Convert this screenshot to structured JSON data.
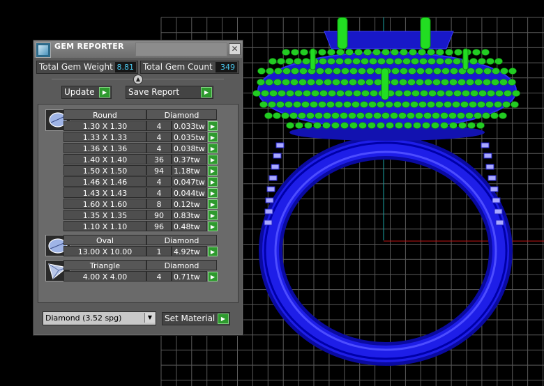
{
  "panel": {
    "title": "GEM REPORTER",
    "close_glyph": "✕",
    "total_weight_label": "Total Gem Weight",
    "total_weight_value": "8.81",
    "total_count_label": "Total Gem Count",
    "total_count_value": "349",
    "update_label": "Update",
    "save_report_label": "Save Report",
    "collapse_glyph": "▲",
    "arrow_glyph": "▶",
    "dropdown_glyph": "▼",
    "set_material_label": "Set Material",
    "material_value": "Diamond    (3.52 spg)"
  },
  "groups": [
    {
      "shape": "Round",
      "material": "Diamond",
      "icon": "round-gem-icon",
      "rows": [
        {
          "size": "1.30 X 1.30",
          "count": "4",
          "weight": "0.033tw"
        },
        {
          "size": "1.33 X 1.33",
          "count": "4",
          "weight": "0.035tw"
        },
        {
          "size": "1.36 X 1.36",
          "count": "4",
          "weight": "0.038tw"
        },
        {
          "size": "1.40 X 1.40",
          "count": "36",
          "weight": "0.37tw"
        },
        {
          "size": "1.50 X 1.50",
          "count": "94",
          "weight": "1.18tw"
        },
        {
          "size": "1.46 X 1.46",
          "count": "4",
          "weight": "0.047tw"
        },
        {
          "size": "1.43 X 1.43",
          "count": "4",
          "weight": "0.044tw"
        },
        {
          "size": "1.60 X 1.60",
          "count": "8",
          "weight": "0.12tw"
        },
        {
          "size": "1.35 X 1.35",
          "count": "90",
          "weight": "0.83tw"
        },
        {
          "size": "1.10 X 1.10",
          "count": "96",
          "weight": "0.48tw"
        }
      ]
    },
    {
      "shape": "Oval",
      "material": "Diamond",
      "icon": "oval-gem-icon",
      "rows": [
        {
          "size": "13.00 X 10.00",
          "count": "1",
          "weight": "4.92tw"
        }
      ]
    },
    {
      "shape": "Triangle",
      "material": "Diamond",
      "icon": "triangle-gem-icon",
      "rows": [
        {
          "size": "4.00 X 4.00",
          "count": "4",
          "weight": "0.71tw"
        }
      ]
    }
  ],
  "colors": {
    "ring_metal": "#1515e6",
    "gems": "#22cc22",
    "grid": "#5a5a5a",
    "accent_value": "#4bc9ef"
  }
}
